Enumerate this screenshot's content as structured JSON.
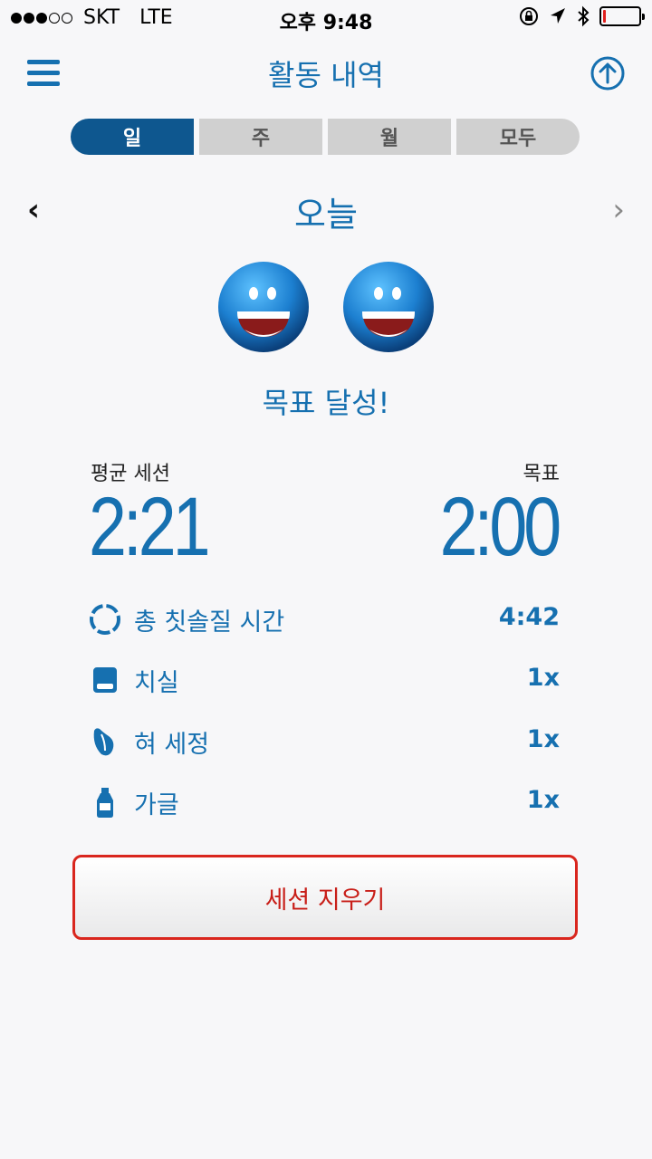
{
  "status_bar": {
    "carrier": "SKT",
    "network": "LTE",
    "time": "오후 9:48",
    "battery_level": 0.05
  },
  "header": {
    "title": "활동 내역",
    "menu_icon": "hamburger-menu-icon",
    "share_icon": "upload-arrow-icon"
  },
  "tabs": [
    {
      "label": "일",
      "active": true
    },
    {
      "label": "주",
      "active": false
    },
    {
      "label": "월",
      "active": false
    },
    {
      "label": "모두",
      "active": false
    }
  ],
  "date_nav": {
    "prev": "‹",
    "label": "오늘",
    "next": "›"
  },
  "goal_message": "목표 달성!",
  "stats": {
    "avg_session_label": "평균 세션",
    "avg_session_value": "2:21",
    "goal_label": "목표",
    "goal_value": "2:00"
  },
  "activities": [
    {
      "label": "총 칫솔질 시간",
      "value": "4:42",
      "icon": "timer-ring-icon"
    },
    {
      "label": "치실",
      "value": "1x",
      "icon": "floss-icon"
    },
    {
      "label": "혀 세정",
      "value": "1x",
      "icon": "tongue-icon"
    },
    {
      "label": "가글",
      "value": "1x",
      "icon": "mouthwash-bottle-icon"
    }
  ],
  "clear_button": "세션 지우기",
  "colors": {
    "primary": "#1670b0",
    "active_tab": "#0e578f",
    "danger": "#d9261e"
  }
}
